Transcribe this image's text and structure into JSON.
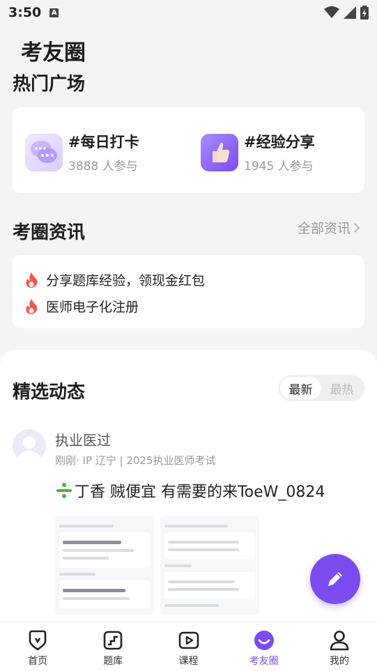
{
  "status": {
    "time": "3:50"
  },
  "app": {
    "title": "考友圈"
  },
  "hot": {
    "title": "热门广场",
    "topics": [
      {
        "name": "#每日打卡",
        "count": "3888 人参与",
        "icon": "chat-bubbles-icon"
      },
      {
        "name": "#经验分享",
        "count": "1945 人参与",
        "icon": "thumbs-up-icon"
      }
    ]
  },
  "news": {
    "title": "考圈资讯",
    "all_label": "全部资讯",
    "items": [
      {
        "text": "分享题库经验，领现金红包",
        "icon": "flame-icon"
      },
      {
        "text": "医师电子化注册",
        "icon": "flame-icon"
      }
    ]
  },
  "feed": {
    "title": "精选动态",
    "tabs": [
      "最新",
      "最热"
    ],
    "active_tab": "最新",
    "post": {
      "user": "执业医过",
      "meta": "刚刚· IP 辽宁 | 2025执业医师考试",
      "text": "丁香 贼便宜 有需要的来ToeW_0824"
    }
  },
  "tabbar": {
    "items": [
      {
        "label": "首页",
        "icon": "home-icon"
      },
      {
        "label": "题库",
        "icon": "question-bank-icon"
      },
      {
        "label": "课程",
        "icon": "course-play-icon"
      },
      {
        "label": "考友圈",
        "icon": "community-icon"
      },
      {
        "label": "我的",
        "icon": "profile-icon"
      }
    ],
    "active": "考友圈"
  },
  "colors": {
    "accent": "#7a4cf0",
    "flame": "#f05a4a",
    "background": "#f4f4f6"
  }
}
